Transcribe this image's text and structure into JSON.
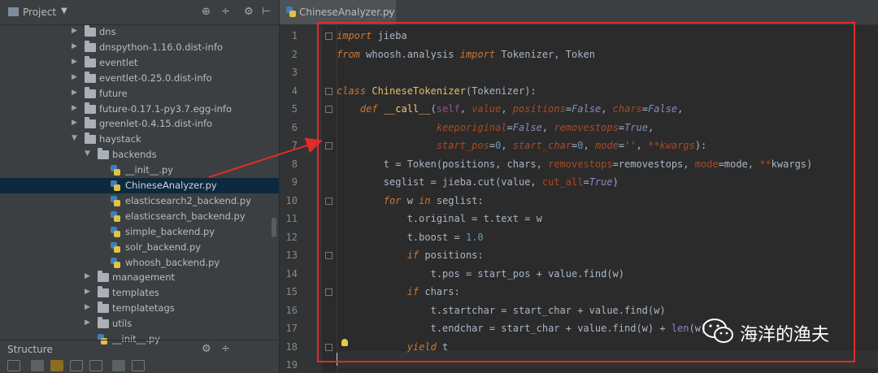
{
  "project_panel": {
    "title": "Project",
    "caret": "▼",
    "tools": [
      "⊕",
      "÷",
      "⚙",
      "⊢"
    ],
    "tree": [
      {
        "label": "dns",
        "kind": "folder",
        "depth": 1,
        "expanded": false
      },
      {
        "label": "dnspython-1.16.0.dist-info",
        "kind": "folder",
        "depth": 1,
        "expanded": false
      },
      {
        "label": "eventlet",
        "kind": "folder",
        "depth": 1,
        "expanded": false
      },
      {
        "label": "eventlet-0.25.0.dist-info",
        "kind": "folder",
        "depth": 1,
        "expanded": false
      },
      {
        "label": "future",
        "kind": "folder",
        "depth": 1,
        "expanded": false
      },
      {
        "label": "future-0.17.1-py3.7.egg-info",
        "kind": "folder",
        "depth": 1,
        "expanded": false
      },
      {
        "label": "greenlet-0.4.15.dist-info",
        "kind": "folder",
        "depth": 1,
        "expanded": false
      },
      {
        "label": "haystack",
        "kind": "folder",
        "depth": 1,
        "expanded": true
      },
      {
        "label": "backends",
        "kind": "folder",
        "depth": 2,
        "expanded": true
      },
      {
        "label": "__init__.py",
        "kind": "file",
        "depth": 3
      },
      {
        "label": "ChineseAnalyzer.py",
        "kind": "file",
        "depth": 3,
        "selected": true
      },
      {
        "label": "elasticsearch2_backend.py",
        "kind": "file",
        "depth": 3
      },
      {
        "label": "elasticsearch_backend.py",
        "kind": "file",
        "depth": 3
      },
      {
        "label": "simple_backend.py",
        "kind": "file",
        "depth": 3
      },
      {
        "label": "solr_backend.py",
        "kind": "file",
        "depth": 3
      },
      {
        "label": "whoosh_backend.py",
        "kind": "file",
        "depth": 3
      },
      {
        "label": "management",
        "kind": "folder",
        "depth": 2,
        "expanded": false
      },
      {
        "label": "templates",
        "kind": "folder",
        "depth": 2,
        "expanded": false
      },
      {
        "label": "templatetags",
        "kind": "folder",
        "depth": 2,
        "expanded": false
      },
      {
        "label": "utils",
        "kind": "folder",
        "depth": 2,
        "expanded": false
      },
      {
        "label": "__init__.py",
        "kind": "file",
        "depth": 2
      }
    ]
  },
  "structure_panel": {
    "title": "Structure",
    "tools": [
      "⚙",
      "÷"
    ]
  },
  "editor": {
    "tab_label": "ChineseAnalyzer.py",
    "tab_close": "×",
    "line_numbers": [
      "1",
      "2",
      "3",
      "4",
      "5",
      "6",
      "7",
      "8",
      "9",
      "10",
      "11",
      "12",
      "13",
      "14",
      "15",
      "16",
      "17",
      "18",
      "19"
    ],
    "code_lines": [
      "import jieba",
      "from whoosh.analysis import Tokenizer, Token",
      "",
      "class ChineseTokenizer(Tokenizer):",
      "    def __call__(self, value, positions=False, chars=False,",
      "                 keeporiginal=False, removestops=True,",
      "                 start_pos=0, start_char=0, mode='', **kwargs):",
      "        t = Token(positions, chars, removestops=removestops, mode=mode, **kwargs)",
      "        seglist = jieba.cut(value, cut_all=True)",
      "        for w in seglist:",
      "            t.original = t.text = w",
      "            t.boost = 1.0",
      "            if positions:",
      "                t.pos = start_pos + value.find(w)",
      "            if chars:",
      "                t.startchar = start_char + value.find(w)",
      "                t.endchar = start_char + value.find(w) + len(w)",
      "            yield t",
      ""
    ]
  },
  "watermark": {
    "text": "海洋的渔夫"
  },
  "colors": {
    "highlight_box": "#e02b2b",
    "selected_row": "#0d293e"
  }
}
